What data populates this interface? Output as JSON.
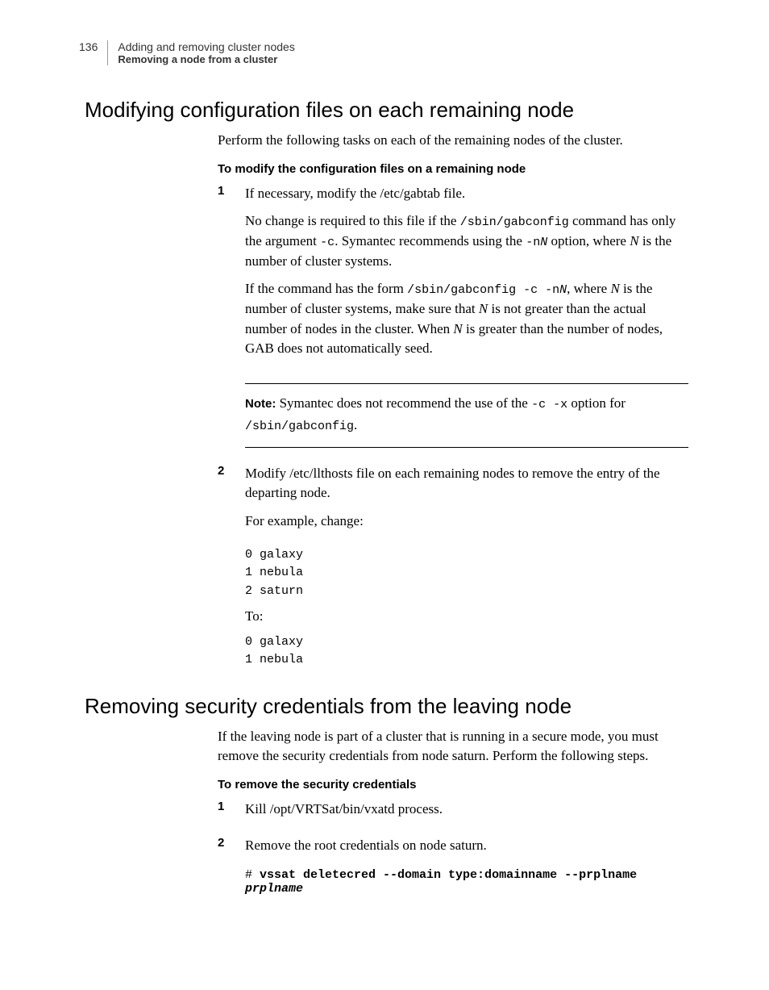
{
  "header": {
    "page_number": "136",
    "chapter": "Adding and removing cluster nodes",
    "section": "Removing a node from a cluster"
  },
  "section1": {
    "title": "Modifying configuration files on each remaining node",
    "intro": "Perform the following tasks on each of the remaining nodes of the cluster.",
    "subtask": "To modify the configuration files on a remaining node",
    "step1": {
      "num": "1",
      "p1": "If necessary, modify the /etc/gabtab file.",
      "p2a": "No change is required to this file if the ",
      "p2b": "/sbin/gabconfig",
      "p2c": " command has only the argument ",
      "p2d": "-c",
      "p2e": ". Symantec recommends using the ",
      "p2f": "-n",
      "p2g": "N",
      "p2h": " option, where ",
      "p2i": "N",
      "p2j": " is the number of cluster systems.",
      "p3a": "If the command has the form ",
      "p3b": "/sbin/gabconfig -c -n",
      "p3c": "N",
      "p3d": ", where ",
      "p3e": "N",
      "p3f": " is the number of cluster systems, make sure that ",
      "p3g": "N",
      "p3h": " is not greater than the actual number of nodes in the cluster. When ",
      "p3i": "N",
      "p3j": " is greater than the number of nodes, GAB does not automatically seed.",
      "note_label": "Note:",
      "note_a": " Symantec does not recommend the use of the ",
      "note_b": "-c -x",
      "note_c": " option for",
      "note_d": "/sbin/gabconfig",
      "note_e": "."
    },
    "step2": {
      "num": "2",
      "p1": "Modify /etc/llthosts file on each remaining nodes to remove the entry of the departing node.",
      "p2": "For example, change:",
      "code1": "0 galaxy\n1 nebula\n2 saturn",
      "p3": "To:",
      "code2": "0 galaxy\n1 nebula"
    }
  },
  "section2": {
    "title": "Removing security credentials from the leaving node",
    "intro": "If the leaving node is part of a cluster that is running in a secure mode, you must remove the security credentials from node saturn. Perform the following steps.",
    "subtask": "To remove the security credentials",
    "step1": {
      "num": "1",
      "text": "Kill /opt/VRTSat/bin/vxatd process."
    },
    "step2": {
      "num": "2",
      "text": "Remove the root credentials on node saturn.",
      "cmd_prompt": "# ",
      "cmd": "vssat deletecred --domain type:domainname --prplname ",
      "cmd_arg": "prplname"
    }
  }
}
